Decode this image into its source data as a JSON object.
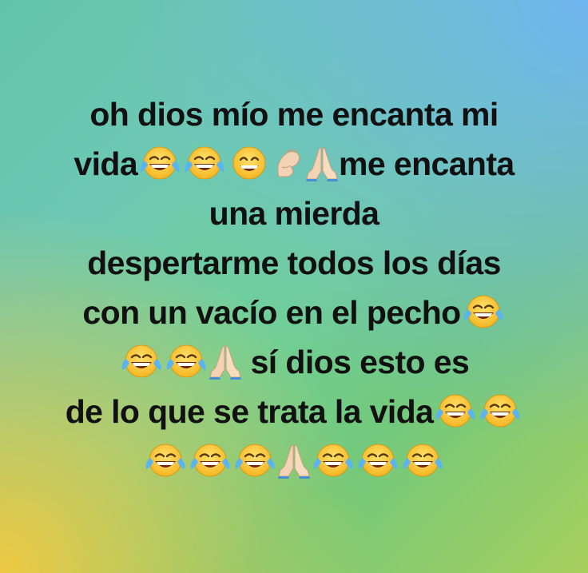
{
  "post": {
    "line1": "oh dios mío me encanta mi",
    "line2_a": "vida",
    "line2_b": "me encanta",
    "line3": "una mierda",
    "line4": "despertarme todos los días",
    "line5": "con un vacío en el pecho",
    "line6": "sí dios esto es",
    "line7": "de lo que se trata la vida"
  },
  "emoji": {
    "laugh": "face-with-tears-of-joy-icon",
    "grin": "grinning-face-icon",
    "pray": "folded-hands-icon",
    "pinched": "pinched-hand-icon"
  },
  "colors": {
    "text": "#111111",
    "bg_top_right": "#6eb4f5",
    "bg_center": "#70cf9a",
    "bg_bottom_left": "#f5c83c"
  }
}
